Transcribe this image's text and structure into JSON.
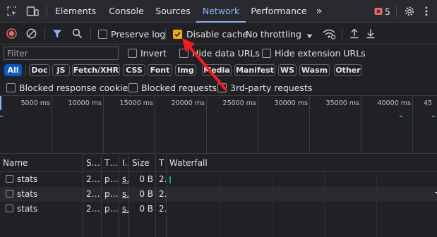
{
  "tabs": {
    "items": [
      "Elements",
      "Console",
      "Sources",
      "Network",
      "Performance"
    ],
    "active": "Network",
    "more": "»",
    "issues_count": "5",
    "issues_color": "#e46962",
    "accent": "#8ab4f8"
  },
  "toolbar": {
    "preserve_log": "Preserve log",
    "disable_cache": "Disable cache",
    "disable_cache_checked": true,
    "throttling": "No throttling"
  },
  "filter": {
    "placeholder": "Filter",
    "invert": "Invert",
    "hide_data_urls": "Hide data URLs",
    "hide_extension_urls": "Hide extension URLs"
  },
  "types": [
    "All",
    "Doc",
    "JS",
    "Fetch/XHR",
    "CSS",
    "Font",
    "Img",
    "Media",
    "Manifest",
    "WS",
    "Wasm",
    "Other"
  ],
  "blocked": {
    "blocked_response_cookies": "Blocked response cookies",
    "blocked_requests": "Blocked requests",
    "third_party_requests": "3rd-party requests"
  },
  "overview": {
    "ticks": [
      "5000 ms",
      "10000 ms",
      "15000 ms",
      "20000 ms",
      "25000 ms",
      "30000 ms",
      "35000 ms",
      "40000 ms",
      "45"
    ]
  },
  "table": {
    "columns": [
      "Name",
      "S…",
      "T…",
      "I…",
      "Size",
      "T",
      "Waterfall"
    ],
    "rows": [
      {
        "name": "stats",
        "status": "2…",
        "type": "p…",
        "initiator": "s…",
        "size": "0 B",
        "time": "2…"
      },
      {
        "name": "stats",
        "status": "2…",
        "type": "p…",
        "initiator": "s…",
        "size": "0 B",
        "time": "2…"
      },
      {
        "name": "stats",
        "status": "2…",
        "type": "p…",
        "initiator": "s…",
        "size": "0 B",
        "time": "2…"
      }
    ]
  },
  "annotation": {
    "arrow_color": "#ff1a1a"
  }
}
